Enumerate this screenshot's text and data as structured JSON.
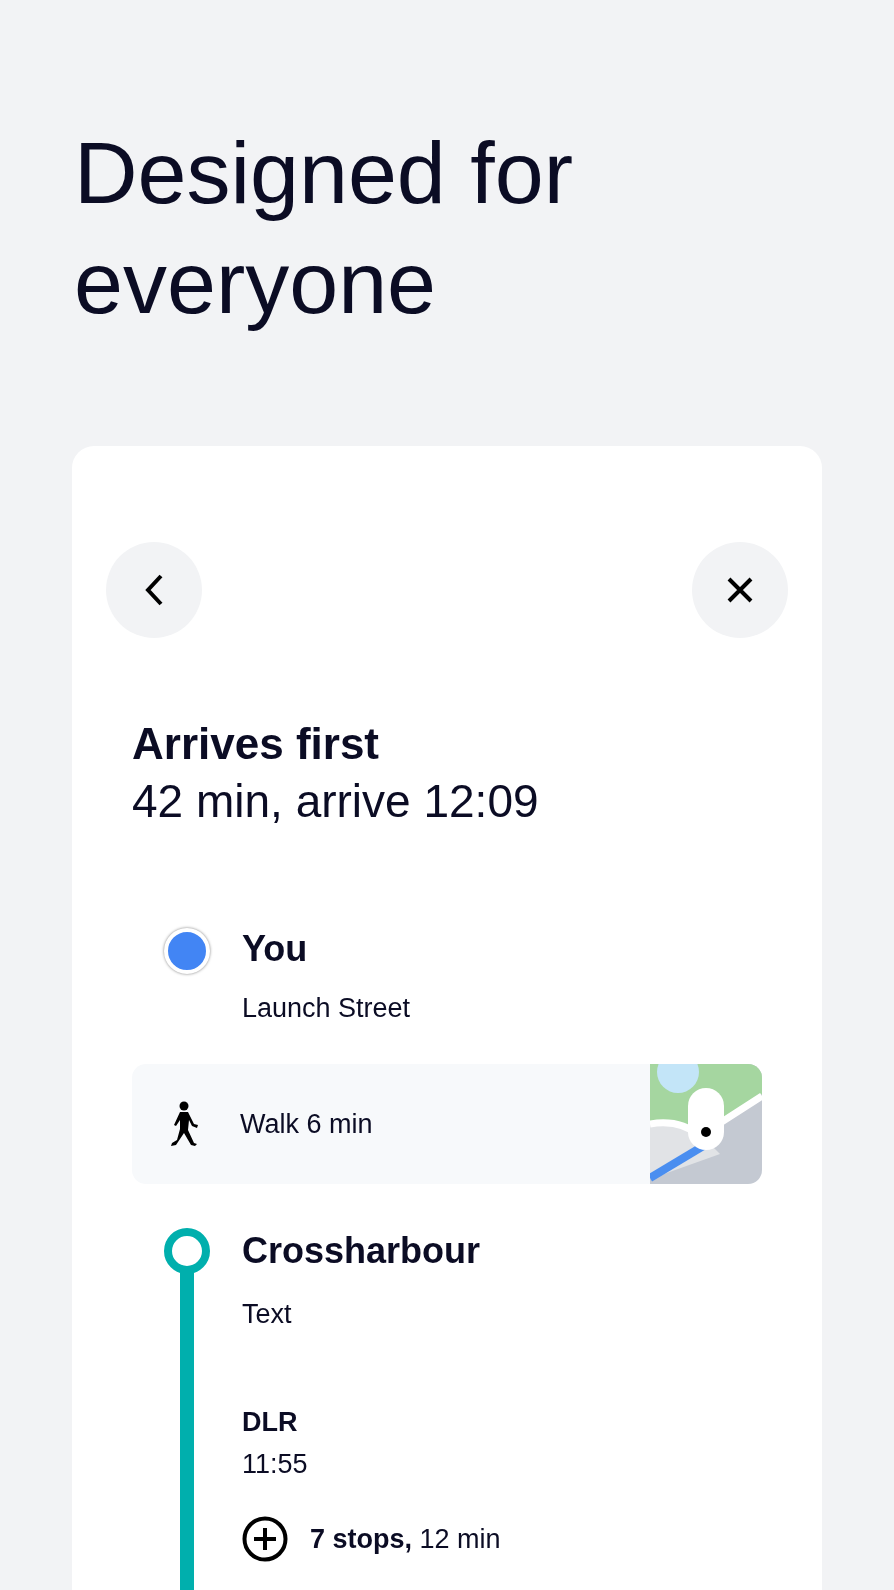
{
  "headline": "Designed for everyone",
  "journey": {
    "title": "Arrives first",
    "summary": "42 min, arrive 12:09",
    "origin": {
      "name": "You",
      "place": "Launch Street"
    },
    "walk": {
      "label": "Walk 6 min"
    },
    "station": {
      "name": "Crossharbour",
      "detail": "Text",
      "line": "DLR",
      "time": "11:55",
      "stops": "7 stops,",
      "duration": "12 min",
      "expanded": false
    }
  }
}
